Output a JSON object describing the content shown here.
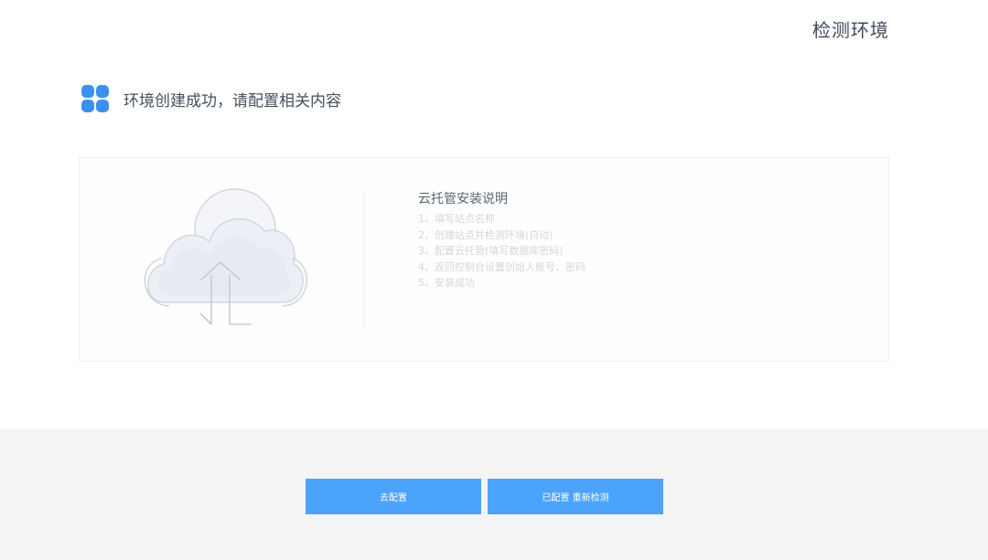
{
  "header": {
    "title": "检测环境"
  },
  "status": {
    "icon": "app-grid-icon",
    "message": "环境创建成功，请配置相关内容"
  },
  "instructions": {
    "illustration": "cloud-upload-icon",
    "title": "云托管安装说明",
    "steps": [
      "1、填写站点名称",
      "2、创建站点并检测环境(自动)",
      "3、配置云托管(填写数据库密码)",
      "4、返回控制台设置创始人账号、密码",
      "5、安装成功"
    ]
  },
  "actions": {
    "configure_label": "去配置",
    "recheck_label": "已配置 重新检测"
  },
  "colors": {
    "accent": "#4ba3fb",
    "icon_blue": "#3d8ff0",
    "footer_bg": "#f4f4f5"
  }
}
